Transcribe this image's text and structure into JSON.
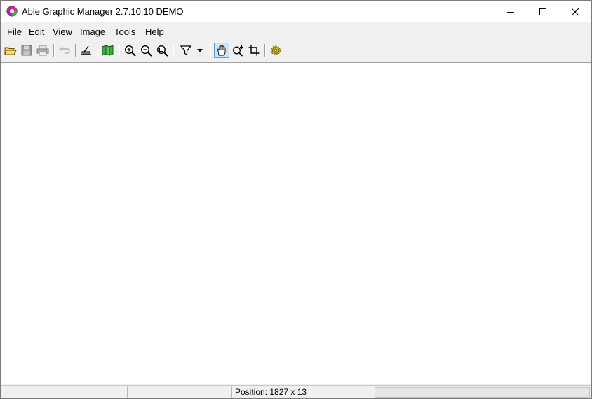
{
  "window": {
    "title": "Able Graphic Manager 2.7.10.10 DEMO",
    "controls": {
      "minimize": "minimize-icon",
      "maximize": "maximize-icon",
      "close": "close-icon"
    }
  },
  "menu": {
    "items": [
      "File",
      "Edit",
      "View",
      "Image",
      "Tools",
      "Help"
    ]
  },
  "toolbar": {
    "icons": [
      "open-folder-icon",
      "save-icon",
      "print-icon",
      "undo-icon",
      "scan-icon",
      "book-icon",
      "zoom-in-icon",
      "zoom-out-icon",
      "zoom-fit-icon",
      "filter-icon",
      "filter-dropdown-icon",
      "pan-hand-icon",
      "zoom-tool-icon",
      "crop-icon",
      "settings-gear-icon"
    ],
    "active_tool": "pan-hand-icon"
  },
  "status": {
    "position_text": "Position: 1827 x 13"
  },
  "colors": {
    "titlebar": "#ffffff",
    "chrome": "#f0f0f0",
    "active_tool_bg": "#cce4f7",
    "active_tool_border": "#5aa0d8"
  }
}
